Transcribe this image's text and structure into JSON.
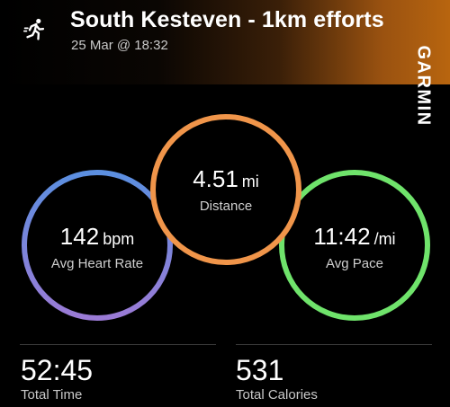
{
  "activity": {
    "title": "South Kesteven - 1km efforts",
    "datetime": "25 Mar @ 18:32",
    "icon": "running-icon"
  },
  "brand": {
    "name": "GARMIN"
  },
  "metrics": {
    "distance": {
      "value": "4.51",
      "unit": "mi",
      "label": "Distance",
      "ring_color": "#F0954A"
    },
    "heart_rate": {
      "value": "142",
      "unit": "bpm",
      "label": "Avg Heart Rate",
      "ring_colors": [
        "#5B8FE0",
        "#9B7BD6"
      ]
    },
    "pace": {
      "value": "11:42",
      "unit": "/mi",
      "label": "Avg Pace",
      "ring_color": "#6FE36B"
    }
  },
  "stats": {
    "total_time": {
      "value": "52:45",
      "label": "Total Time"
    },
    "total_calories": {
      "value": "531",
      "label": "Total Calories"
    }
  }
}
